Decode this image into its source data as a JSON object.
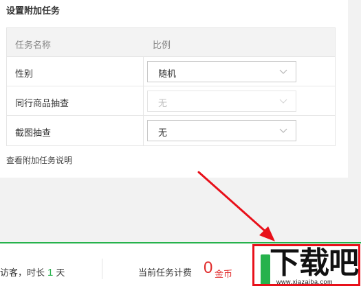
{
  "section": {
    "title": "设置附加任务"
  },
  "table": {
    "headers": {
      "name": "任务名称",
      "ratio": "比例"
    },
    "rows": [
      {
        "name": "性别",
        "value": "随机",
        "disabled": false
      },
      {
        "name": "同行商品抽查",
        "value": "无",
        "disabled": true
      },
      {
        "name": "截图抽查",
        "value": "无",
        "disabled": false
      }
    ]
  },
  "help_link": "查看附加任务说明",
  "bottom_bar": {
    "left_prefix": "访客，时长",
    "days_value": "1",
    "days_unit": "天",
    "fee_label": "当前任务计费",
    "fee_value": "0",
    "fee_unit": "金币"
  },
  "watermark": {
    "text": "下载吧",
    "url": "www.xiazaiba.com"
  },
  "colors": {
    "accent_green": "#26b24c",
    "alert_red": "#e02a2a",
    "highlight_red": "#e8101a"
  },
  "icons": [
    "chevron-down-icon",
    "annotation-arrow"
  ]
}
